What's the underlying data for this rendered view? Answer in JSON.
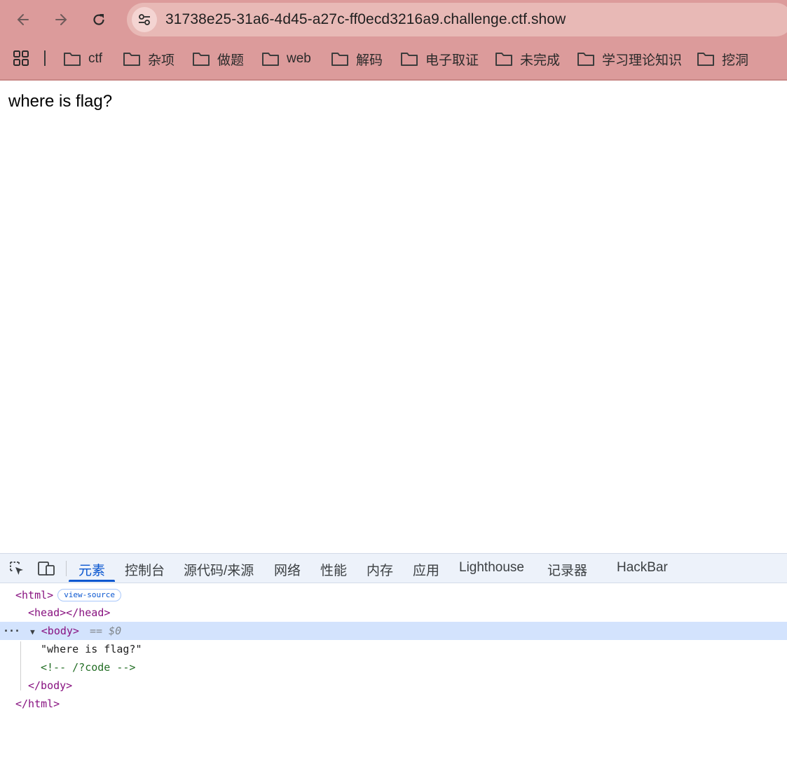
{
  "browser": {
    "url": "31738e25-31a6-4d45-a27c-ff0ecd3216a9.challenge.ctf.show",
    "bookmarks": [
      "ctf",
      "杂项",
      "做题",
      "web",
      "解码",
      "电子取证",
      "未完成",
      "学习理论知识",
      "挖洞"
    ]
  },
  "page": {
    "text": "where is flag?"
  },
  "devtools": {
    "tabs": [
      "元素",
      "控制台",
      "源代码/来源",
      "网络",
      "性能",
      "内存",
      "应用",
      "Lighthouse",
      "记录器",
      "HackBar"
    ],
    "dom": {
      "html_open": "<html>",
      "view_source": "view-source",
      "head": "<head></head>",
      "body_open": "<body>",
      "selected_marker": "== $0",
      "text_node": "\"where is flag?\"",
      "comment": "<!-- /?code -->",
      "body_close": "</body>",
      "html_close": "</html>"
    }
  },
  "colors": {
    "chrome_bg": "#dc9b9b",
    "omnibox_bg": "#e8b9b6",
    "devtools_accent": "#0b57d0",
    "selected_row": "#d3e3fd",
    "tag_color": "#881280",
    "comment_color": "#236e25"
  }
}
